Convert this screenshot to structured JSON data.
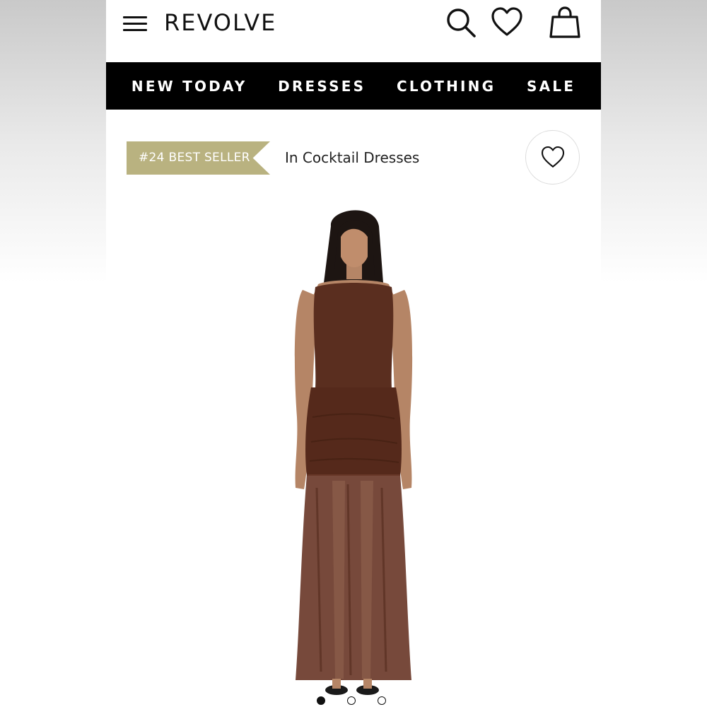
{
  "header": {
    "logo": "REVOLVE",
    "icons": [
      "menu-icon",
      "search-icon",
      "heart-icon",
      "shopping-bag-icon"
    ]
  },
  "nav": {
    "items": [
      {
        "label": "NEW TODAY"
      },
      {
        "label": "DRESSES"
      },
      {
        "label": "CLOTHING"
      },
      {
        "label": "SALE"
      }
    ]
  },
  "product": {
    "badge": "#24 BEST SELLER",
    "badge_context": "In Cocktail Dresses",
    "badge_color": "#b9b280",
    "dress_color": "#5a2e1f",
    "wishlist_icon": "heart-outline-icon",
    "image_count": 3,
    "active_image": 1
  }
}
